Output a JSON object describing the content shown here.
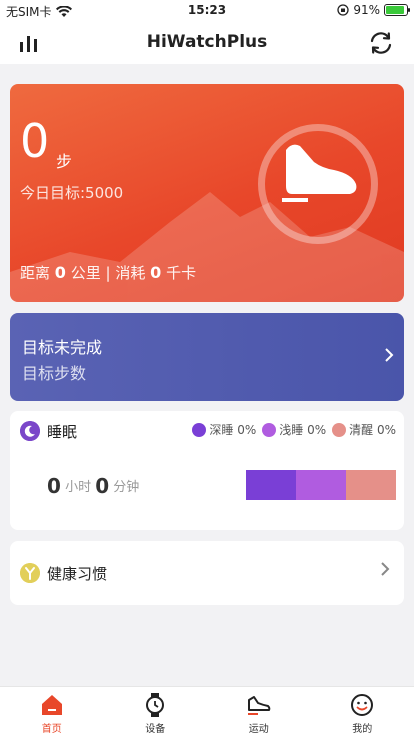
{
  "status_bar": {
    "carrier": "无SIM卡",
    "time": "15:23",
    "battery": "91%",
    "battery_level": 0.91
  },
  "header": {
    "title": "HiWatchPlus"
  },
  "steps": {
    "value": "0",
    "unit": "步",
    "goal": "今日目标:5000",
    "distance_label": "距离",
    "distance_value": "0",
    "distance_unit": "公里",
    "separator": "|",
    "calorie_label": "消耗",
    "calorie_value": "0",
    "calorie_unit": "千卡"
  },
  "goal": {
    "title": "目标未完成",
    "subtitle": "目标步数"
  },
  "sleep": {
    "title": "睡眠",
    "legend": [
      {
        "label": "深睡 0%",
        "color": "#7a3fd6"
      },
      {
        "label": "浅睡 0%",
        "color": "#b05ce0"
      },
      {
        "label": "清醒 0%",
        "color": "#e59089"
      }
    ],
    "hours": "0",
    "hours_unit": "小时",
    "minutes": "0",
    "minutes_unit": "分钟"
  },
  "habit": {
    "label": "健康习惯"
  },
  "tabs": [
    {
      "label": "首页",
      "icon": "home-icon"
    },
    {
      "label": "设备",
      "icon": "watch-icon"
    },
    {
      "label": "运动",
      "icon": "sneaker-icon"
    },
    {
      "label": "我的",
      "icon": "smiley-icon"
    }
  ],
  "colors": {
    "accent": "#e8472a",
    "goal_card": "#4a55aa"
  }
}
